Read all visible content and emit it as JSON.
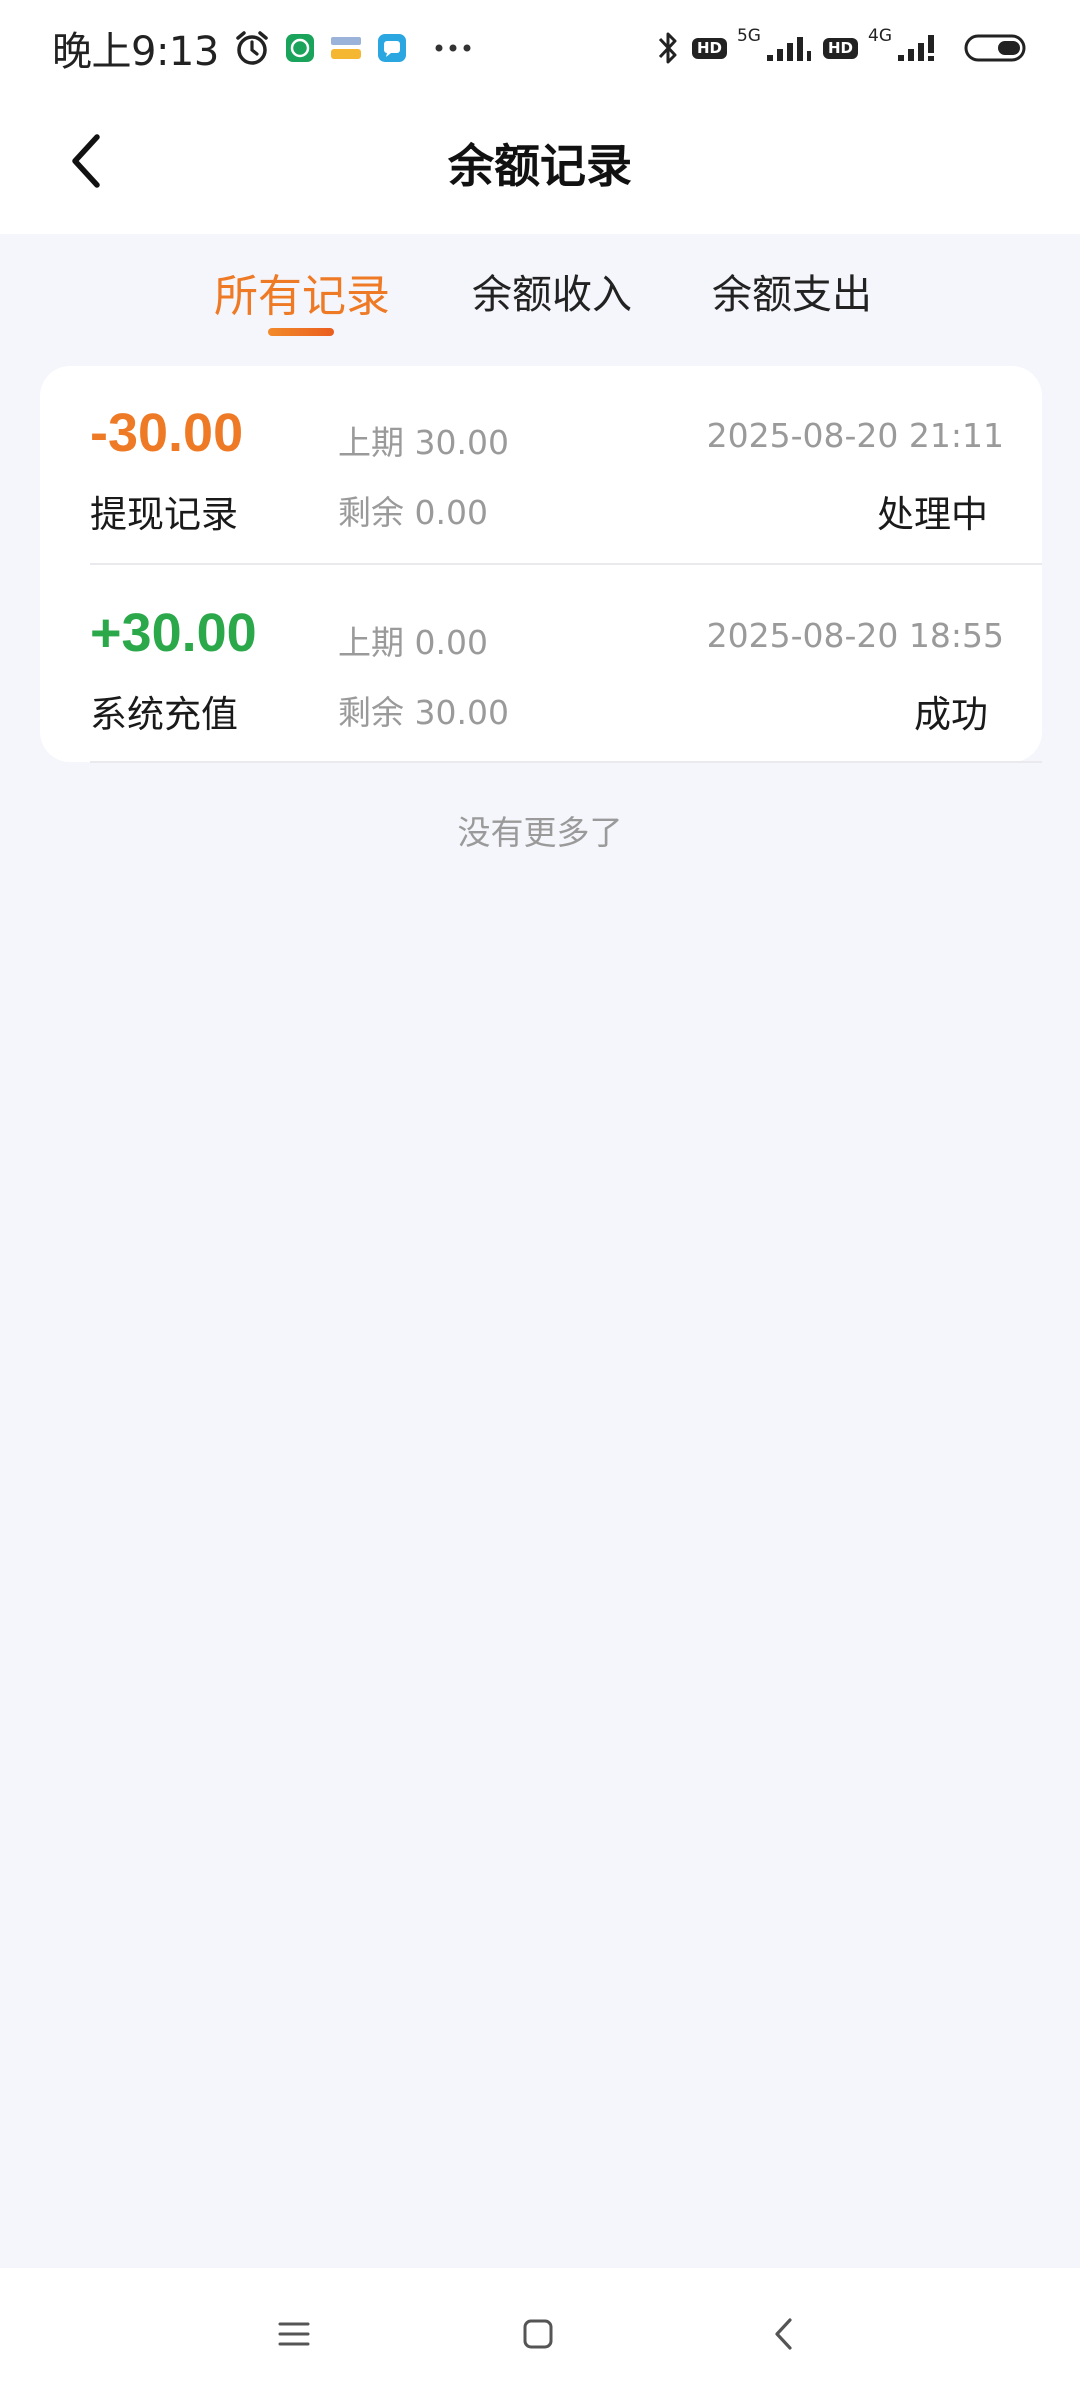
{
  "status_bar": {
    "time": "晚上9:13",
    "left_icons": [
      "alarm-icon",
      "green-app-icon",
      "yellow-app-icon",
      "message-app-icon",
      "more-dots-icon"
    ],
    "right_icons": [
      "bluetooth-icon",
      "hd-icon",
      "signal-5g-icon",
      "hd-icon",
      "signal-4g-icon",
      "battery-icon"
    ],
    "hd_label": "HD",
    "net1": "5G",
    "net2": "4G"
  },
  "header": {
    "title": "余额记录"
  },
  "tabs": [
    {
      "label": "所有记录",
      "active": true
    },
    {
      "label": "余额收入",
      "active": false
    },
    {
      "label": "余额支出",
      "active": false
    }
  ],
  "records": [
    {
      "amount": "-30.00",
      "amount_color": "#ee7a26",
      "type": "提现记录",
      "prev": "上期 30.00",
      "remain": "剩余 0.00",
      "time": "2025-08-20 21:11",
      "status": "处理中"
    },
    {
      "amount": "+30.00",
      "amount_color": "#2aa84a",
      "type": "系统充值",
      "prev": "上期 0.00",
      "remain": "剩余 30.00",
      "time": "2025-08-20 18:55",
      "status": "成功"
    }
  ],
  "footer_text": "没有更多了",
  "colors": {
    "accent": "#ee7a26",
    "success": "#2aa84a",
    "background": "#f5f6fb"
  }
}
